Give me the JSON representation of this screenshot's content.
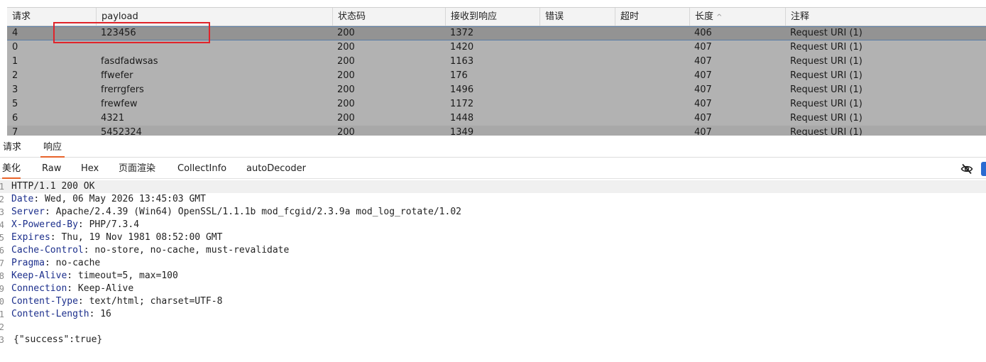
{
  "table": {
    "columns": [
      "请求",
      "payload",
      "状态码",
      "接收到响应",
      "错误",
      "超时",
      "长度",
      "注释"
    ],
    "sort_indicator": "^",
    "rows": [
      {
        "req": "4",
        "payload": "123456",
        "status": "200",
        "received": "1372",
        "error": "",
        "timeout": "",
        "length": "406",
        "comment": "Request URI (1)"
      },
      {
        "req": "0",
        "payload": "",
        "status": "200",
        "received": "1420",
        "error": "",
        "timeout": "",
        "length": "407",
        "comment": "Request URI (1)"
      },
      {
        "req": "1",
        "payload": "fasdfadwsas",
        "status": "200",
        "received": "1163",
        "error": "",
        "timeout": "",
        "length": "407",
        "comment": "Request URI (1)"
      },
      {
        "req": "2",
        "payload": "ffwefer",
        "status": "200",
        "received": "176",
        "error": "",
        "timeout": "",
        "length": "407",
        "comment": "Request URI (1)"
      },
      {
        "req": "3",
        "payload": "frerrgfers",
        "status": "200",
        "received": "1496",
        "error": "",
        "timeout": "",
        "length": "407",
        "comment": "Request URI (1)"
      },
      {
        "req": "5",
        "payload": "frewfew",
        "status": "200",
        "received": "1172",
        "error": "",
        "timeout": "",
        "length": "407",
        "comment": "Request URI (1)"
      },
      {
        "req": "6",
        "payload": "4321",
        "status": "200",
        "received": "1448",
        "error": "",
        "timeout": "",
        "length": "407",
        "comment": "Request URI (1)"
      },
      {
        "req": "7",
        "payload": "5452324",
        "status": "200",
        "received": "1349",
        "error": "",
        "timeout": "",
        "length": "407",
        "comment": "Request URI (1)"
      }
    ]
  },
  "main_tabs": [
    "请求",
    "响应"
  ],
  "sub_tabs": [
    "美化",
    "Raw",
    "Hex",
    "页面渲染",
    "CollectInfo",
    "autoDecoder"
  ],
  "editor": {
    "lines": [
      {
        "num": "1",
        "key": "HTTP/1.1 200 OK",
        "val": ""
      },
      {
        "num": "2",
        "key": "Date",
        "val": ": Wed, 06 May 2026 13:45:03 GMT"
      },
      {
        "num": "3",
        "key": "Server",
        "val": ": Apache/2.4.39 (Win64) OpenSSL/1.1.1b mod_fcgid/2.3.9a mod_log_rotate/1.02"
      },
      {
        "num": "4",
        "key": "X-Powered-By",
        "val": ": PHP/7.3.4"
      },
      {
        "num": "5",
        "key": "Expires",
        "val": ": Thu, 19 Nov 1981 08:52:00 GMT"
      },
      {
        "num": "6",
        "key": "Cache-Control",
        "val": ": no-store, no-cache, must-revalidate"
      },
      {
        "num": "7",
        "key": "Pragma",
        "val": ": no-cache"
      },
      {
        "num": "8",
        "key": "Keep-Alive",
        "val": ": timeout=5, max=100"
      },
      {
        "num": "9",
        "key": "Connection",
        "val": ": Keep-Alive"
      },
      {
        "num": "0",
        "key": "Content-Type",
        "val": ": text/html; charset=UTF-8"
      },
      {
        "num": "1",
        "key": "Content-Length",
        "val": ": 16"
      },
      {
        "num": "2",
        "key": "",
        "val": ""
      },
      {
        "num": "3",
        "key": "",
        "val": "{\"success\":true}"
      }
    ]
  },
  "colors": {
    "highlight": "#e0242b",
    "tab_accent": "#e8632a",
    "header_key": "#1c2f8c"
  }
}
